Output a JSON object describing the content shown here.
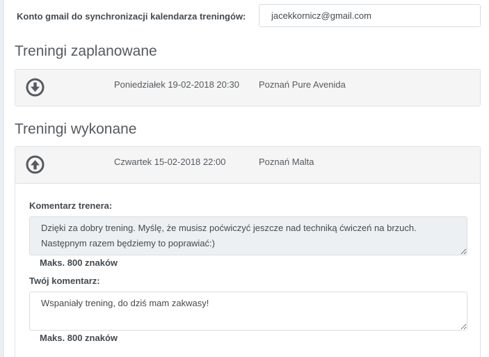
{
  "sync": {
    "label": "Konto gmail do synchronizacji kalendarza treningów:",
    "email": "jacekkornicz@gmail.com"
  },
  "planned": {
    "title": "Treningi zaplanowane",
    "items": [
      {
        "date": "Poniedziałek 19-02-2018 20:30",
        "place": "Poznań Pure Avenida",
        "icon": "arrow-circle-down-icon"
      }
    ]
  },
  "done": {
    "title": "Treningi wykonane",
    "items": [
      {
        "date": "Czwartek 15-02-2018 22:00",
        "place": "Poznań Malta",
        "icon": "arrow-circle-up-icon",
        "trainer_comment_label": "Komentarz trenera:",
        "trainer_comment": "Dzięki za dobry trening. Myślę, że musisz poćwiczyć jeszcze nad techniką ćwiczeń na brzuch.\nNastępnym razem będziemy to poprawiać:)",
        "trainer_limit": "Maks. 800 znaków",
        "your_comment_label": "Twój komentarz:",
        "your_comment": "Wspaniały trening, do dziś mam zakwasy!",
        "your_limit": "Maks. 800 znaków"
      }
    ]
  },
  "colors": {
    "icon": "#555a5f",
    "card_header": "#f5f5f5",
    "readonly_box": "#edf0f2",
    "border": "#dde2e6"
  }
}
